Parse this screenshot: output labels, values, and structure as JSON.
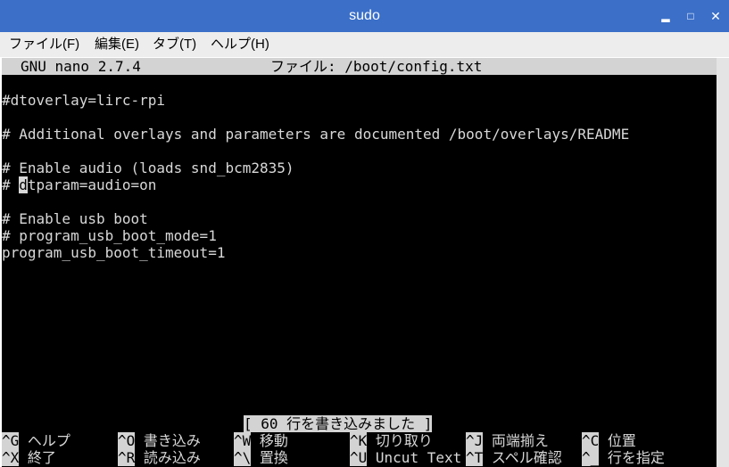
{
  "window": {
    "title": "sudo"
  },
  "menu": [
    "ファイル(F)",
    "編集(E)",
    "タブ(T)",
    "ヘルプ(H)"
  ],
  "nano": {
    "version": "GNU nano 2.7.4",
    "file_label": "ファイル: /boot/config.txt"
  },
  "editor": {
    "lines": [
      "",
      "#dtoverlay=lirc-rpi",
      "",
      "# Additional overlays and parameters are documented /boot/overlays/README",
      "",
      "# Enable audio (loads snd_bcm2835)",
      "# dtparam=audio=on",
      "",
      "# Enable usb boot",
      "# program_usb_boot_mode=1",
      "program_usb_boot_timeout=1"
    ],
    "cursor": {
      "line": 6,
      "char": "d"
    }
  },
  "status": "[ 60 行を書き込みました ]",
  "shortcuts": [
    {
      "key": "^G",
      "label": "ヘルプ"
    },
    {
      "key": "^O",
      "label": "書き込み"
    },
    {
      "key": "^W",
      "label": "移動"
    },
    {
      "key": "^K",
      "label": "切り取り"
    },
    {
      "key": "^J",
      "label": "両端揃え"
    },
    {
      "key": "^C",
      "label": "位置"
    },
    {
      "key": "^X",
      "label": "終了"
    },
    {
      "key": "^R",
      "label": "読み込み"
    },
    {
      "key": "^\\",
      "label": "置換"
    },
    {
      "key": "^U",
      "label": "Uncut Text"
    },
    {
      "key": "^T",
      "label": "スペル確認"
    },
    {
      "key": "^_",
      "label": "行を指定"
    }
  ],
  "colors": {
    "titlebar": "#3b6fc8",
    "terminal_bg": "#000000",
    "terminal_fg": "#d8d8d8",
    "inverse_bg": "#d3d3d3"
  }
}
